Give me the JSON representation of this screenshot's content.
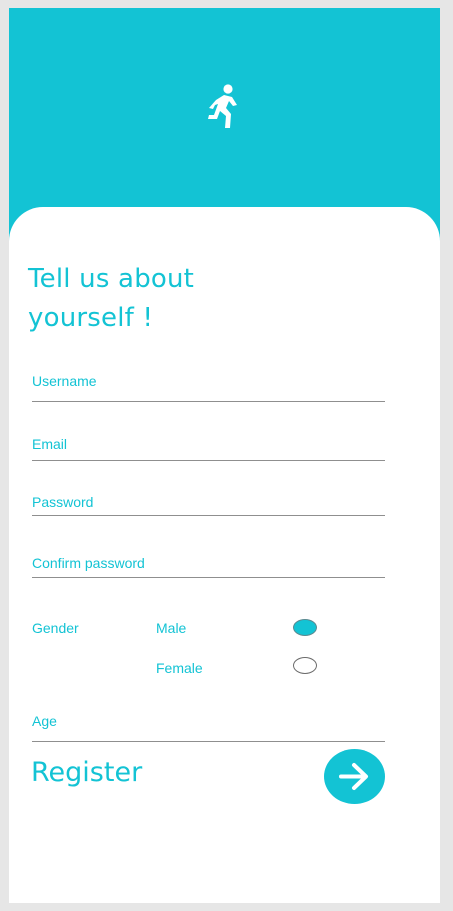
{
  "brand": {
    "accent_color": "#13c3d4",
    "icon": "running-person-icon"
  },
  "form": {
    "title_line1": "Tell us about",
    "title_line2": "yourself !",
    "username_label": "Username",
    "email_label": "Email",
    "password_label": "Password",
    "confirm_password_label": "Confirm password",
    "gender_label": "Gender",
    "gender_options": [
      {
        "label": "Male",
        "selected": true
      },
      {
        "label": "Female",
        "selected": false
      }
    ],
    "age_label": "Age",
    "register_label": "Register",
    "submit_icon": "arrow-right-icon"
  }
}
